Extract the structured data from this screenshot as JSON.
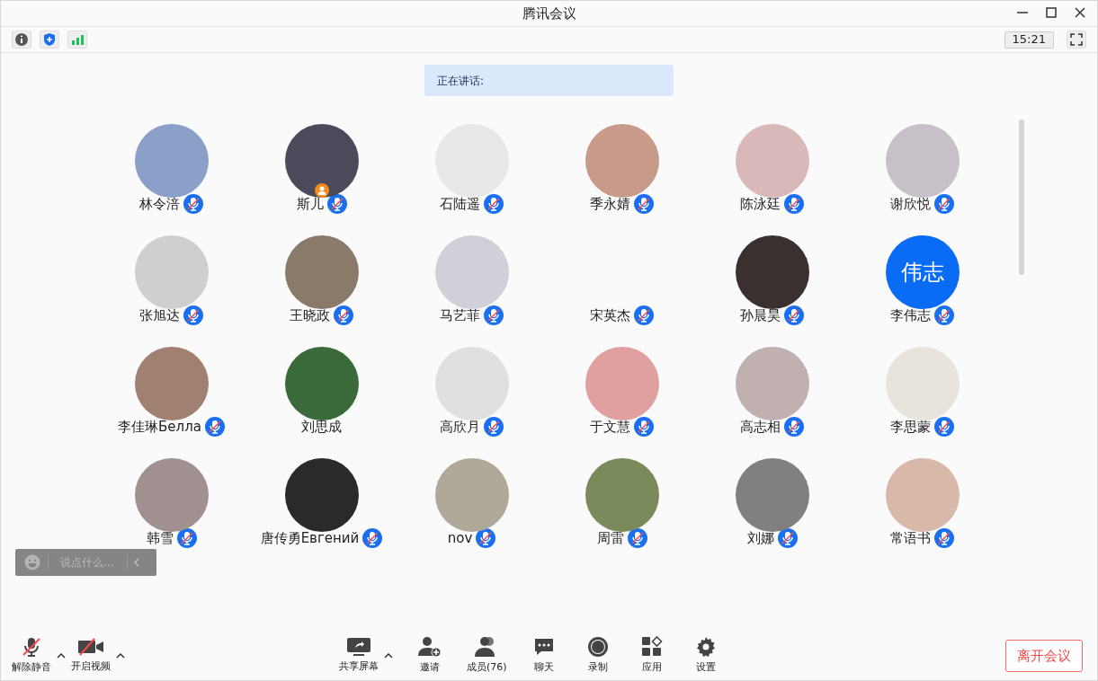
{
  "window": {
    "title": "腾讯会议"
  },
  "toolbar": {
    "time": "15:21"
  },
  "speaking": {
    "label": "正在讲话:"
  },
  "participants": [
    {
      "name": "林令涪",
      "kind": "photo",
      "muted": true,
      "host": false
    },
    {
      "name": "斯儿",
      "kind": "photo",
      "muted": true,
      "host": true
    },
    {
      "name": "石陆遥",
      "kind": "photo",
      "muted": true,
      "host": false
    },
    {
      "name": "季永婧",
      "kind": "photo",
      "muted": true,
      "host": false
    },
    {
      "name": "陈泳廷",
      "kind": "photo",
      "muted": true,
      "host": false
    },
    {
      "name": "谢欣悦",
      "kind": "photo",
      "muted": true,
      "host": false
    },
    {
      "name": "张旭达",
      "kind": "photo",
      "muted": true,
      "host": false
    },
    {
      "name": "王晓政",
      "kind": "photo",
      "muted": true,
      "host": false
    },
    {
      "name": "马艺菲",
      "kind": "photo",
      "muted": true,
      "host": false
    },
    {
      "name": "宋英杰",
      "kind": "blank",
      "muted": true,
      "host": false
    },
    {
      "name": "孙晨昊",
      "kind": "photo",
      "muted": true,
      "host": false
    },
    {
      "name": "李伟志",
      "kind": "initials",
      "initials": "伟志",
      "muted": true,
      "host": false
    },
    {
      "name": "李佳琳Белла",
      "kind": "photo",
      "muted": true,
      "host": false
    },
    {
      "name": "刘思成",
      "kind": "photo",
      "muted": false,
      "host": false
    },
    {
      "name": "高欣月",
      "kind": "photo",
      "muted": true,
      "host": false
    },
    {
      "name": "于文慧",
      "kind": "photo",
      "muted": true,
      "host": false
    },
    {
      "name": "高志相",
      "kind": "photo",
      "muted": true,
      "host": false
    },
    {
      "name": "李思蒙",
      "kind": "photo",
      "muted": true,
      "host": false
    },
    {
      "name": "韩雪",
      "kind": "photo",
      "muted": true,
      "host": false
    },
    {
      "name": "唐传勇Евгений",
      "kind": "photo",
      "muted": true,
      "host": false
    },
    {
      "name": "nov",
      "kind": "photo",
      "muted": true,
      "host": false
    },
    {
      "name": "周雷",
      "kind": "photo",
      "muted": true,
      "host": false
    },
    {
      "name": "刘娜",
      "kind": "photo",
      "muted": true,
      "host": false
    },
    {
      "name": "常语书",
      "kind": "photo",
      "muted": true,
      "host": false
    }
  ],
  "chat_input": {
    "placeholder": "说点什么..."
  },
  "bottom_bar": {
    "left": [
      {
        "label": "解除静音",
        "kind": "mic"
      },
      {
        "label": "开启视频",
        "kind": "video"
      }
    ],
    "center": [
      {
        "label": "共享屏幕",
        "kind": "share"
      },
      {
        "label": "邀请",
        "kind": "invite"
      },
      {
        "label": "成员(76)",
        "kind": "members"
      },
      {
        "label": "聊天",
        "kind": "chat"
      },
      {
        "label": "录制",
        "kind": "record"
      },
      {
        "label": "应用",
        "kind": "apps"
      },
      {
        "label": "设置",
        "kind": "settings"
      }
    ],
    "leave": "离开会议"
  }
}
